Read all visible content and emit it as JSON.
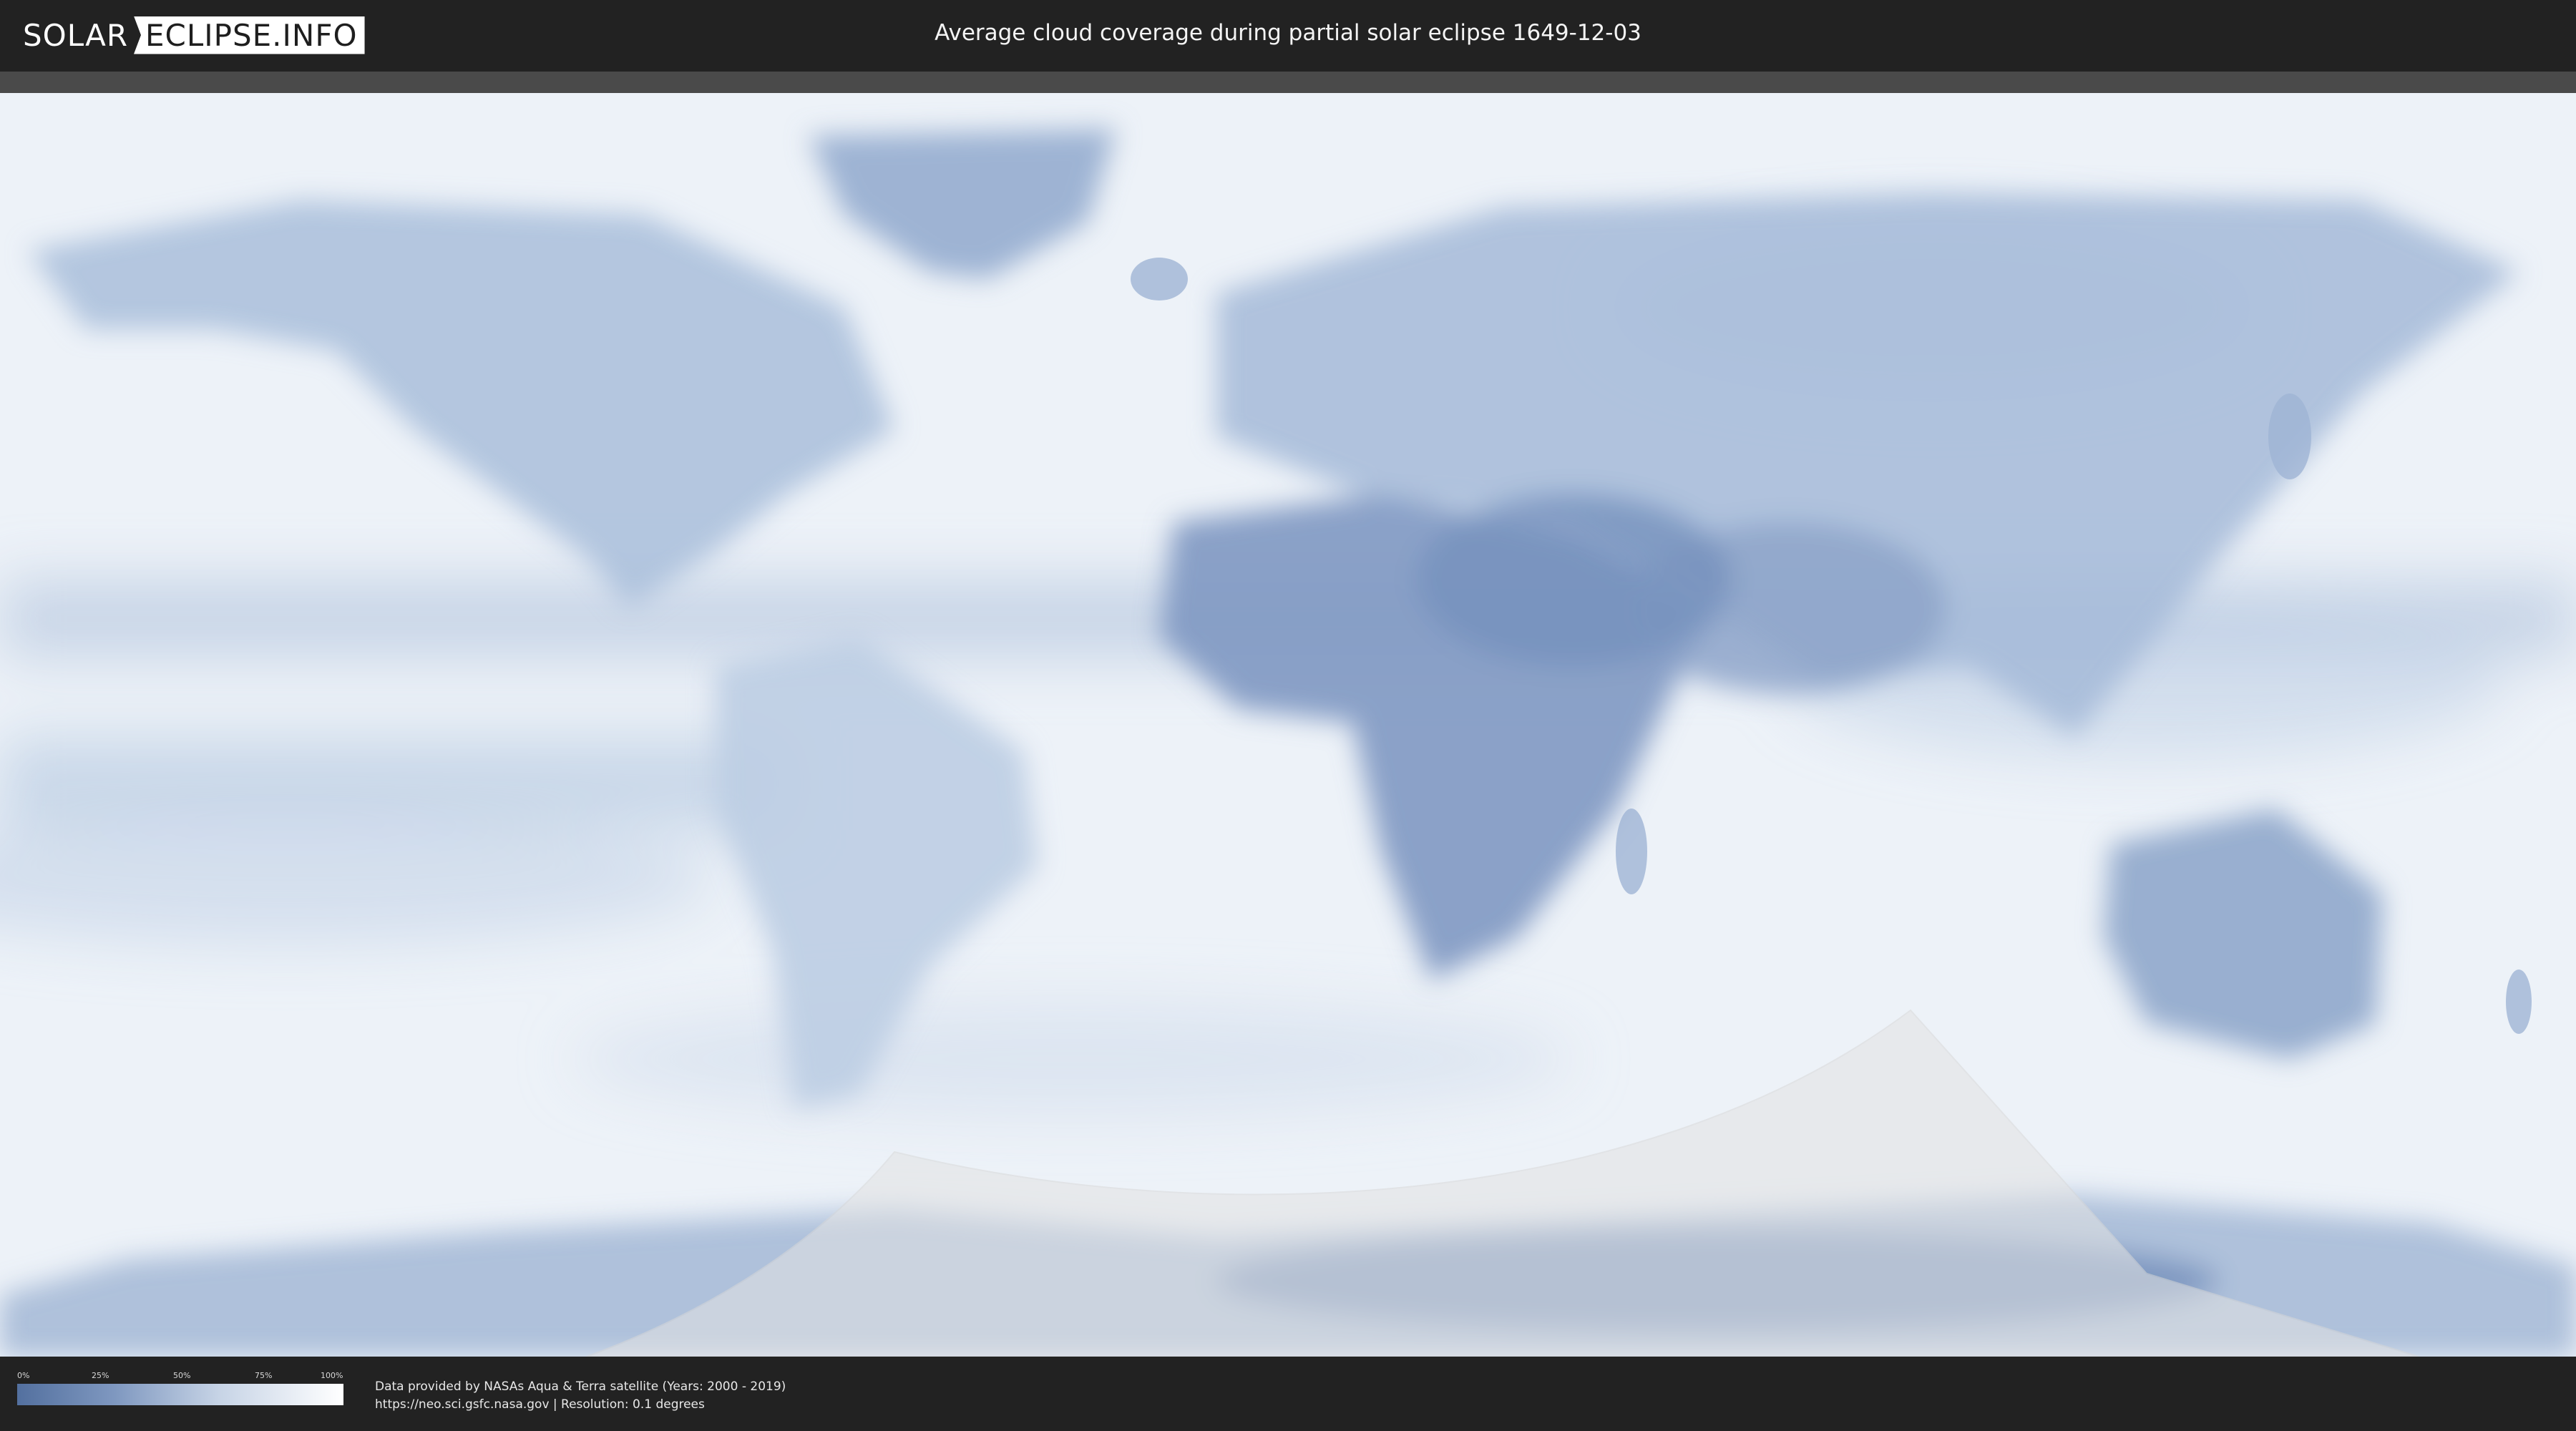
{
  "header": {
    "logo_part1": "SOLAR",
    "logo_part2": "ECLIPSE.INFO",
    "title": "Average cloud coverage during partial solar eclipse 1649-12-03"
  },
  "legend": {
    "ticks": [
      "0%",
      "25%",
      "50%",
      "75%",
      "100%"
    ],
    "color_low": "#53709f",
    "color_high": "#ffffff"
  },
  "footer": {
    "credit_line1": "Data provided by NASAs Aqua & Terra satellite (Years: 2000 - 2019)",
    "credit_line2": "https://neo.sci.gsfc.nasa.gov | Resolution: 0.1 degrees"
  }
}
